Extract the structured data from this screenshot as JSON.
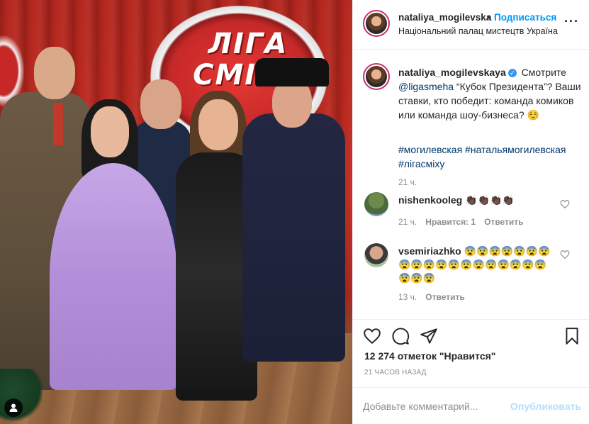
{
  "post": {
    "image_alt": "",
    "owner": {
      "username": "nataliya_mogilevska",
      "follow_label": "Подписаться",
      "location": "Національний палац мистецтв Україна"
    },
    "logo_text": "ЛIГА\nСМIХУ",
    "caption": {
      "username": "nataliya_mogilevskaya",
      "text_before_mention": "Смотрите",
      "mention": "@ligasmeha",
      "text_after_mention": "“Кубок Президента”? Ваши ставки, кто победит: команда комиков или команда шоу-бизнеса? ☺️",
      "hashtags": "#могилевская #натальямогилевская #лігасміху",
      "time": "21 ч."
    },
    "comments": [
      {
        "username": "nishenkooleg",
        "text": "👏🏿👏🏿👏🏿👏🏿",
        "time": "21 ч.",
        "likes_label": "Нравится: 1",
        "reply_label": "Ответить"
      },
      {
        "username": "vsemiriazhko",
        "text": "😨😨😨😨😨😨😨😨😨😨😨😨😨😨😨😨😨😨😨😨😨😨",
        "time": "13 ч.",
        "reply_label": "Ответить"
      }
    ],
    "likes_text": "12 274 отметок \"Нравится\"",
    "posted_ago": "21 часов назад",
    "add_comment_placeholder": "Добавьте комментарий...",
    "publish_label": "Опубликовать"
  },
  "icons": {
    "more": "more-options-icon",
    "heart": "heart-icon",
    "comment": "comment-icon",
    "share": "share-icon",
    "bookmark": "bookmark-icon",
    "user_tag": "user-tag-icon"
  },
  "colors": {
    "link_blue": "#0095f6",
    "muted_gray": "#8e8e8e",
    "mention_blue": "#00376b",
    "disabled_blue": "#b2dffc",
    "story_ring": "#c8306d"
  }
}
